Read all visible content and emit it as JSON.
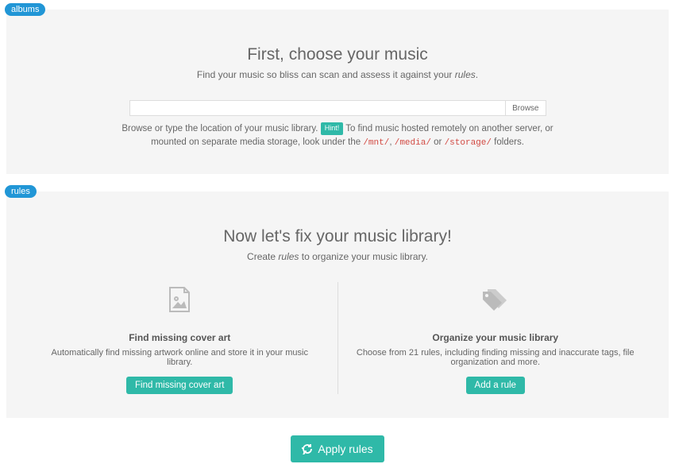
{
  "sections": {
    "albums": {
      "badge": "albums",
      "title": "First, choose your music",
      "subtitle_pre": "Find your music so bliss can scan and assess it against your ",
      "subtitle_em": "rules",
      "subtitle_post": ".",
      "browse_label": "Browse",
      "help_pre": "Browse or type the location of your music library. ",
      "hint_label": "Hint!",
      "help_mid": " To find music hosted remotely on another server, or mounted on separate media storage, look under the ",
      "code1": "/mnt/",
      "sep1": ", ",
      "code2": "/media/",
      "sep2": " or ",
      "code3": "/storage/",
      "help_post": " folders."
    },
    "rules": {
      "badge": "rules",
      "title": "Now let's fix your music library!",
      "subtitle_pre": "Create ",
      "subtitle_em": "rules",
      "subtitle_post": " to organize your music library.",
      "cover": {
        "heading": "Find missing cover art",
        "desc": "Automatically find missing artwork online and store it in your music library.",
        "button": "Find missing cover art"
      },
      "organize": {
        "heading": "Organize your music library",
        "desc": "Choose from 21 rules, including finding missing and inaccurate tags, file organization and more.",
        "button": "Add a rule"
      }
    }
  },
  "apply_label": "Apply rules"
}
